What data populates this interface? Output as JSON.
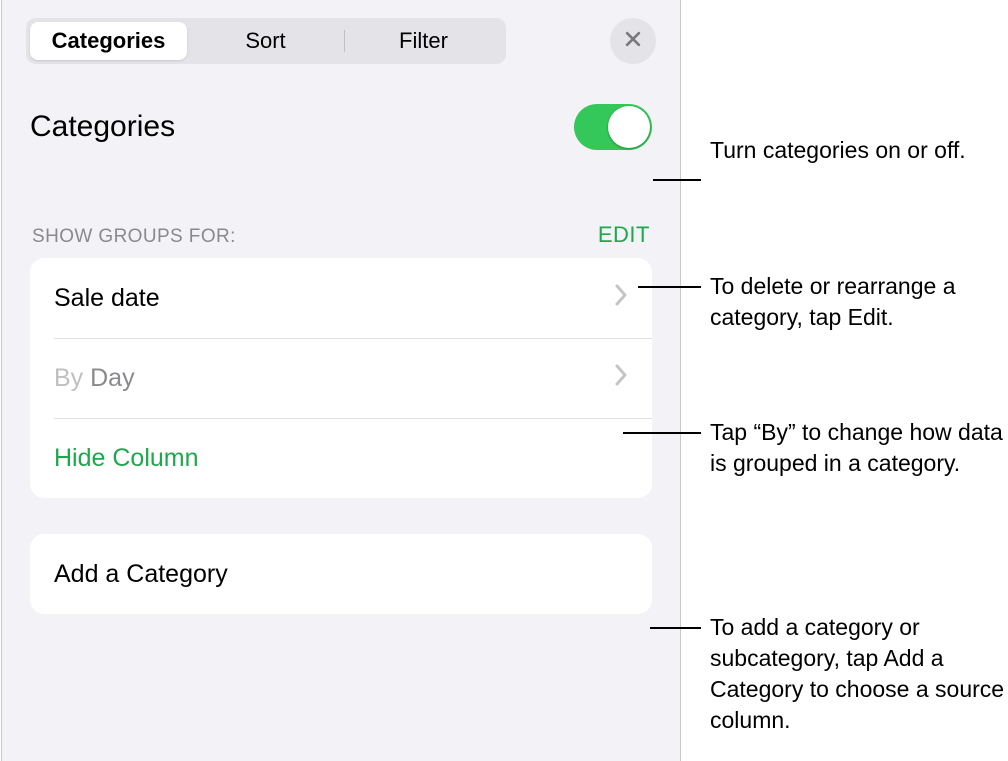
{
  "tabs": {
    "categories": "Categories",
    "sort": "Sort",
    "filter": "Filter"
  },
  "section_title": "Categories",
  "group_header": "SHOW GROUPS FOR:",
  "edit_label": "EDIT",
  "rows": {
    "sale_date": "Sale date",
    "by_prefix": "By ",
    "by_suffix": "Day",
    "hide_column": "Hide Column",
    "add_category": "Add a Category"
  },
  "callouts": {
    "toggle": "Turn categories on or off.",
    "edit": "To delete or rearrange a category, tap Edit.",
    "by": "Tap “By” to change how data is grouped in a category.",
    "add": "To add a category or subcategory, tap Add a Category to choose a source column."
  }
}
